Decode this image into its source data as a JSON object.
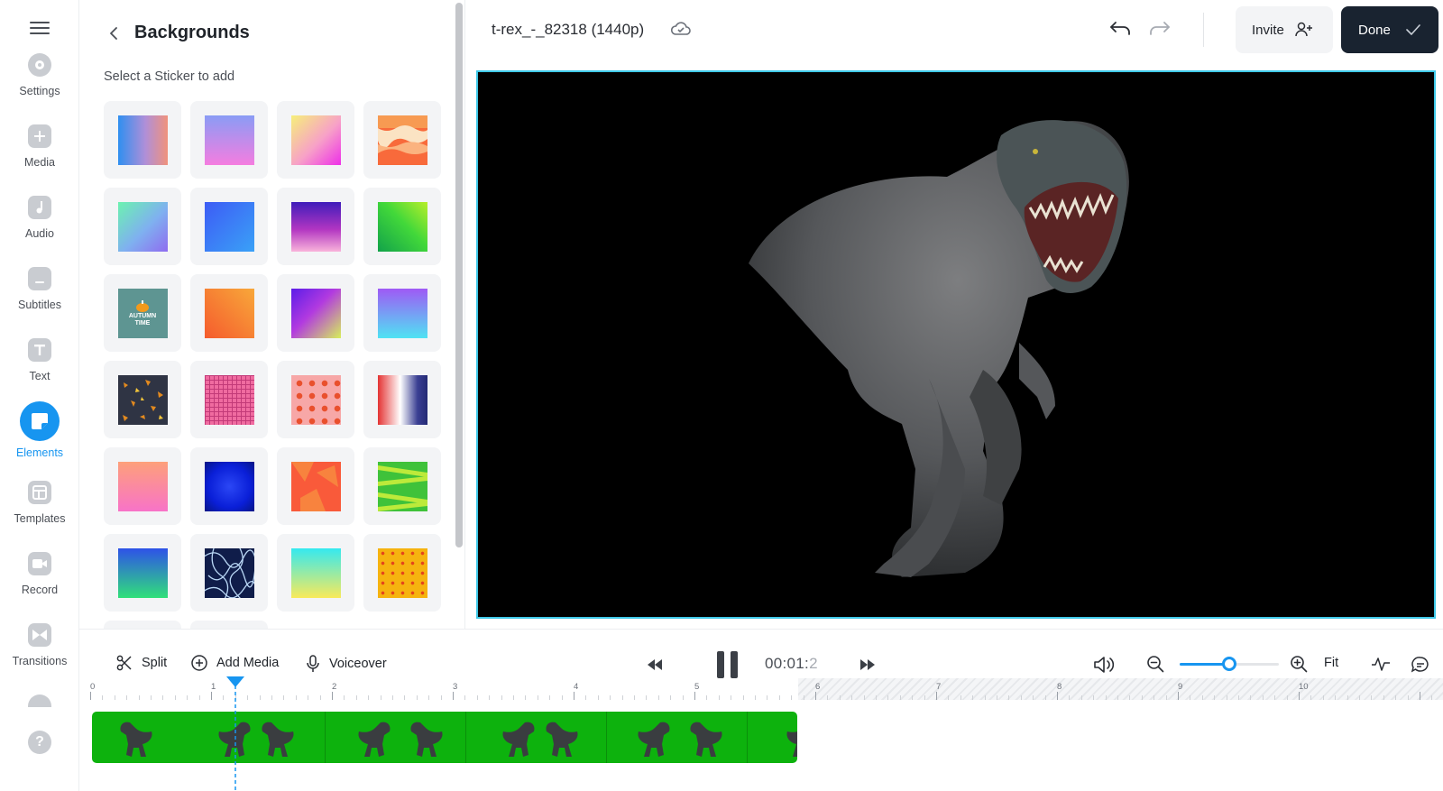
{
  "rail": {
    "items": [
      {
        "label": "Settings",
        "icon": "settings-gear-icon"
      },
      {
        "label": "Media",
        "icon": "media-plus-icon"
      },
      {
        "label": "Audio",
        "icon": "music-note-icon"
      },
      {
        "label": "Subtitles",
        "icon": "subtitles-icon"
      },
      {
        "label": "Text",
        "icon": "text-t-icon"
      },
      {
        "label": "Elements",
        "icon": "elements-sticker-icon",
        "active": true
      },
      {
        "label": "Templates",
        "icon": "templates-layout-icon"
      },
      {
        "label": "Record",
        "icon": "record-camera-icon"
      },
      {
        "label": "Transitions",
        "icon": "transitions-bowtie-icon"
      }
    ],
    "accent": "#1795f0"
  },
  "panel": {
    "title": "Backgrounds",
    "subtitle": "Select a Sticker to add",
    "items": [
      {
        "name": "gradient-blue-pink"
      },
      {
        "name": "gradient-lilac-pink"
      },
      {
        "name": "gradient-yellow-magenta"
      },
      {
        "name": "waves-orange-cream"
      },
      {
        "name": "gradient-mint-violet"
      },
      {
        "name": "gradient-blue"
      },
      {
        "name": "gradient-indigo-pink"
      },
      {
        "name": "gradient-green"
      },
      {
        "name": "autumn-time",
        "text": "AUTUMN TIME"
      },
      {
        "name": "gradient-red-orange"
      },
      {
        "name": "gradient-violet-lime"
      },
      {
        "name": "gradient-violet-cyan"
      },
      {
        "name": "autumn-leaves"
      },
      {
        "name": "pink-grid"
      },
      {
        "name": "pumpkin-pattern"
      },
      {
        "name": "gradient-red-white-navy"
      },
      {
        "name": "gradient-peach-pink"
      },
      {
        "name": "gradient-deep-blue"
      },
      {
        "name": "orange-shapes"
      },
      {
        "name": "green-zigzag"
      },
      {
        "name": "gradient-blue-green"
      },
      {
        "name": "navy-scribble"
      },
      {
        "name": "gradient-cyan-yellow"
      },
      {
        "name": "yellow-floral"
      }
    ]
  },
  "topbar": {
    "project_name": "t-rex_-_82318 (1440p)",
    "invite_label": "Invite",
    "done_label": "Done"
  },
  "toolbar": {
    "split_label": "Split",
    "add_media_label": "Add Media",
    "voiceover_label": "Voiceover",
    "timecode_main": "00:01:",
    "timecode_dim": "2",
    "fit_label": "Fit",
    "zoom_level": 0.5
  },
  "timeline": {
    "ruler_labels": [
      "0",
      "1",
      "2",
      "3",
      "4",
      "5",
      "6",
      "7",
      "8",
      "9",
      "10"
    ],
    "playhead_seconds": 1.2,
    "clip_color": "#0db20d"
  }
}
